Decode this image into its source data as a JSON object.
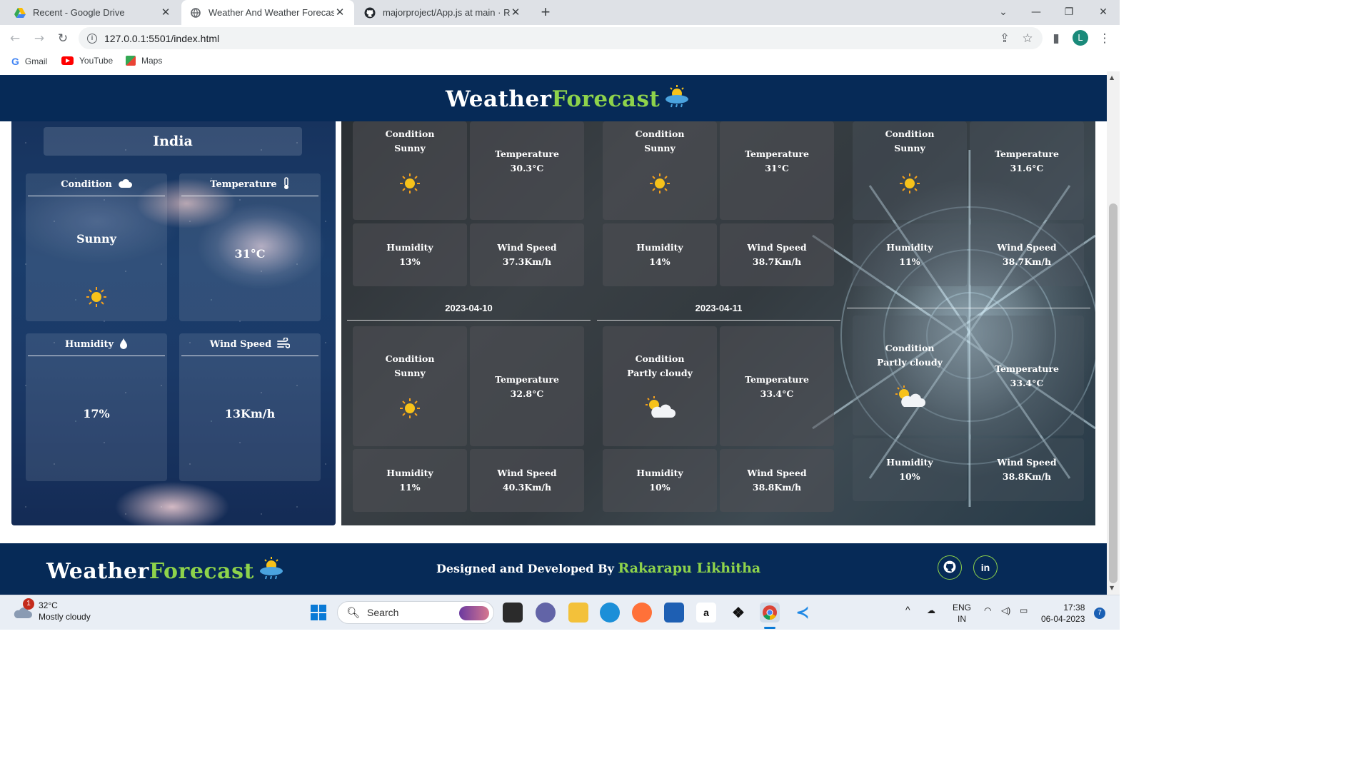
{
  "browser": {
    "tabs": [
      {
        "title": "Recent - Google Drive",
        "icon": "google-drive-icon"
      },
      {
        "title": "Weather And Weather Forecast -",
        "icon": "chrome-page-icon"
      },
      {
        "title": "majorproject/App.js at main · Rak",
        "icon": "github-icon"
      }
    ],
    "url": "127.0.0.1:5501/index.html",
    "profile_initial": "L",
    "bookmarks": [
      {
        "label": "Gmail",
        "icon": "google-icon"
      },
      {
        "label": "YouTube",
        "icon": "youtube-icon"
      },
      {
        "label": "Maps",
        "icon": "maps-icon"
      }
    ]
  },
  "brand": {
    "word1": "Weather",
    "word2": "Forecast"
  },
  "current": {
    "country": "India",
    "condition_label": "Condition",
    "condition_value": "Sunny",
    "temperature_label": "Temperature",
    "temperature_value": "31°C",
    "humidity_label": "Humidity",
    "humidity_value": "17%",
    "wind_label": "Wind Speed",
    "wind_value": "13Km/h"
  },
  "forecast": [
    {
      "date": "",
      "condition_label": "Condition",
      "condition": "Sunny",
      "temperature_label": "Temperature",
      "temperature": "30.3°C",
      "humidity_label": "Humidity",
      "humidity": "13%",
      "wind_label": "Wind Speed",
      "wind": "37.3Km/h"
    },
    {
      "date": "",
      "condition_label": "Condition",
      "condition": "Sunny",
      "temperature_label": "Temperature",
      "temperature": "31°C",
      "humidity_label": "Humidity",
      "humidity": "14%",
      "wind_label": "Wind Speed",
      "wind": "38.7Km/h"
    },
    {
      "date": "",
      "condition_label": "Condition",
      "condition": "Sunny",
      "temperature_label": "Temperature",
      "temperature": "31.6°C",
      "humidity_label": "Humidity",
      "humidity": "11%",
      "wind_label": "Wind Speed",
      "wind": "38.7Km/h"
    },
    {
      "date": "2023-04-10",
      "condition_label": "Condition",
      "condition": "Sunny",
      "temperature_label": "Temperature",
      "temperature": "32.8°C",
      "humidity_label": "Humidity",
      "humidity": "11%",
      "wind_label": "Wind Speed",
      "wind": "40.3Km/h"
    },
    {
      "date": "2023-04-11",
      "condition_label": "Condition",
      "condition": "Partly cloudy",
      "temperature_label": "Temperature",
      "temperature": "33.4°C",
      "humidity_label": "Humidity",
      "humidity": "10%",
      "wind_label": "Wind Speed",
      "wind": "38.8Km/h"
    },
    {
      "date": "",
      "condition_label": "Condition",
      "condition": "Partly cloudy",
      "temperature_label": "Temperature",
      "temperature": "33.4°C",
      "humidity_label": "Humidity",
      "humidity": "10%",
      "wind_label": "Wind Speed",
      "wind": "38.8Km/h"
    }
  ],
  "footer": {
    "credit_prefix": "Designed and Developed By",
    "credit_name": "Rakarapu Likhitha",
    "github_icon": "github-icon",
    "linkedin_label": "in"
  },
  "taskbar": {
    "weather_temp": "32°C",
    "weather_desc": "Mostly cloudy",
    "weather_badge": "1",
    "search_label": "Search",
    "lang": "ENG",
    "region": "IN",
    "time": "17:38",
    "date": "06-04-2023",
    "notif_count": "7"
  },
  "colors": {
    "navy": "#062a57",
    "accent_green": "#8ed34b",
    "sun": "#f7c21a"
  }
}
